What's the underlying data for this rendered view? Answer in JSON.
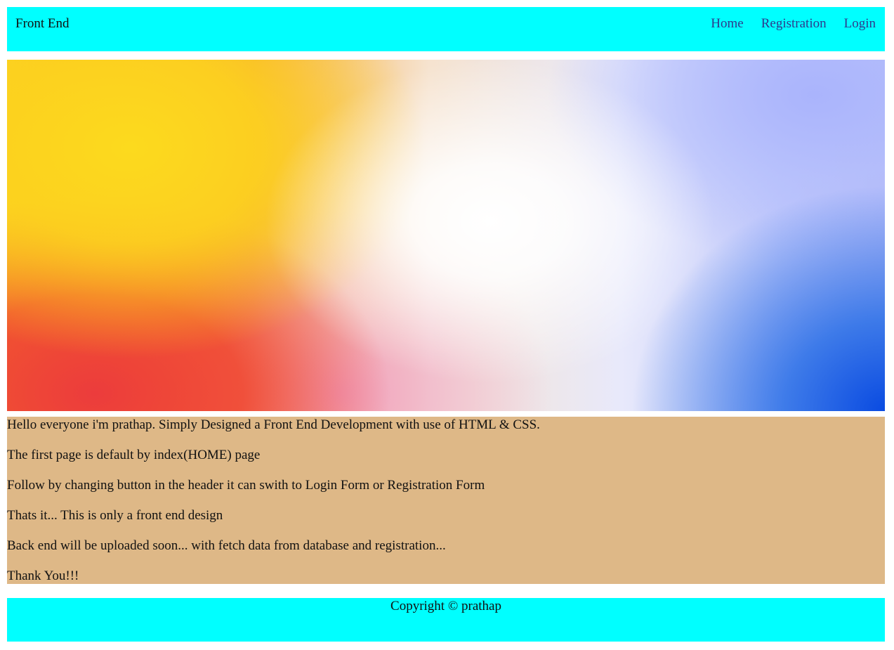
{
  "header": {
    "brand": "Front End",
    "nav": [
      {
        "label": "Home"
      },
      {
        "label": "Registration"
      },
      {
        "label": "Login"
      }
    ]
  },
  "content": {
    "paragraphs": [
      "Hello everyone i'm prathap. Simply Designed a Front End Development with use of HTML & CSS.",
      "The first page is default by index(HOME) page",
      "Follow by changing button in the header it can swith to Login Form or Registration Form",
      "Thats it... This is only a front end design",
      "Back end will be uploaded soon... with fetch data from database and registration...",
      "Thank You!!!"
    ]
  },
  "footer": {
    "copyright": "Copyright © prathap"
  },
  "colors": {
    "header_bg": "#00ffff",
    "content_bg": "#deb887",
    "nav_link": "#2e3a8c"
  }
}
